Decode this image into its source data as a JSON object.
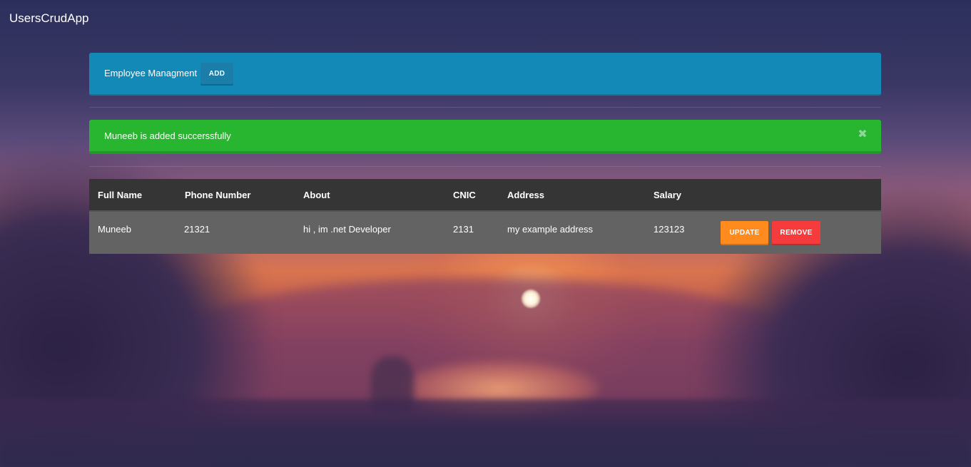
{
  "app": {
    "title": "UsersCrudApp"
  },
  "header": {
    "title": "Employee Managment",
    "add_label": "ADD"
  },
  "alert": {
    "message": "Muneeb is added succerssfully",
    "close_glyph": "✖"
  },
  "table": {
    "columns": [
      "Full Name",
      "Phone Number",
      "About",
      "CNIC",
      "Address",
      "Salary"
    ],
    "rows": [
      {
        "full_name": "Muneeb",
        "phone": "21321",
        "about": "hi , im .net Developer",
        "cnic": "2131",
        "address": "my example address",
        "salary": "123123",
        "update_label": "UPDATE",
        "remove_label": "REMOVE"
      }
    ]
  },
  "colors": {
    "header_bg": "#1389b8",
    "alert_bg": "#28b52f",
    "table_head_bg": "#353535",
    "table_row_bg": "#636363",
    "update_button": "#ff8a1e",
    "remove_button": "#f53b3b"
  }
}
